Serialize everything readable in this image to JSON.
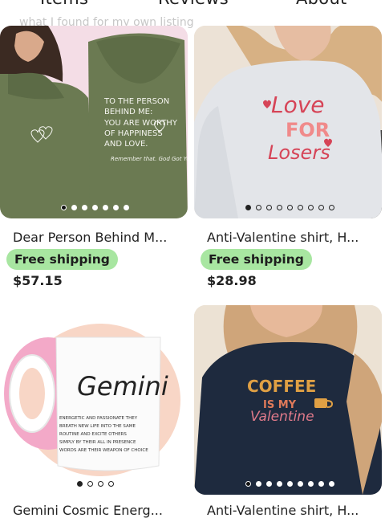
{
  "tabs": [
    {
      "label": "Items"
    },
    {
      "label": "Reviews"
    },
    {
      "label": "About"
    }
  ],
  "header": {
    "faded_text": "what I found for my own listing"
  },
  "products": [
    {
      "title": "Dear Person Behind M...",
      "badge": "Free shipping",
      "price": "$57.15",
      "image_text": [
        "TO THE PERSON",
        "BEHIND ME:",
        "YOU ARE WORTHY",
        "OF HAPPINESS",
        "AND LOVE.",
        "Remember that. God Got You!"
      ],
      "image_count": 7,
      "active_image": 1
    },
    {
      "title": "Anti-Valentine shirt, H...",
      "badge": "Free shipping",
      "price": "$28.98",
      "image_text": [
        "Love",
        "FOR",
        "Losers"
      ],
      "image_count": 9,
      "active_image": 1
    },
    {
      "title": "Gemini Cosmic Energ...",
      "image_text": [
        "Gemini",
        "ENERGETIC AND PASSIONATE THEY",
        "BREATH NEW LIFE INTO THE SAME",
        "ROUTINE AND EXCITE OTHERS",
        "SIMPLY BY THEIR ALL IN PRESENCE",
        "WORDS ARE THEIR WEAPON OF CHOICE"
      ],
      "image_count": 4,
      "active_image": 1
    },
    {
      "title": "Anti-Valentine shirt, H...",
      "image_text": [
        "COFFEE",
        "IS MY",
        "Valentine"
      ],
      "image_count": 9,
      "active_image": 1
    }
  ],
  "colors": {
    "badge_bg": "#a8e6a1",
    "hoodie_green": "#6b7a52",
    "sweatshirt_gray": "#e4e6ea",
    "navy": "#1e2a3e"
  }
}
